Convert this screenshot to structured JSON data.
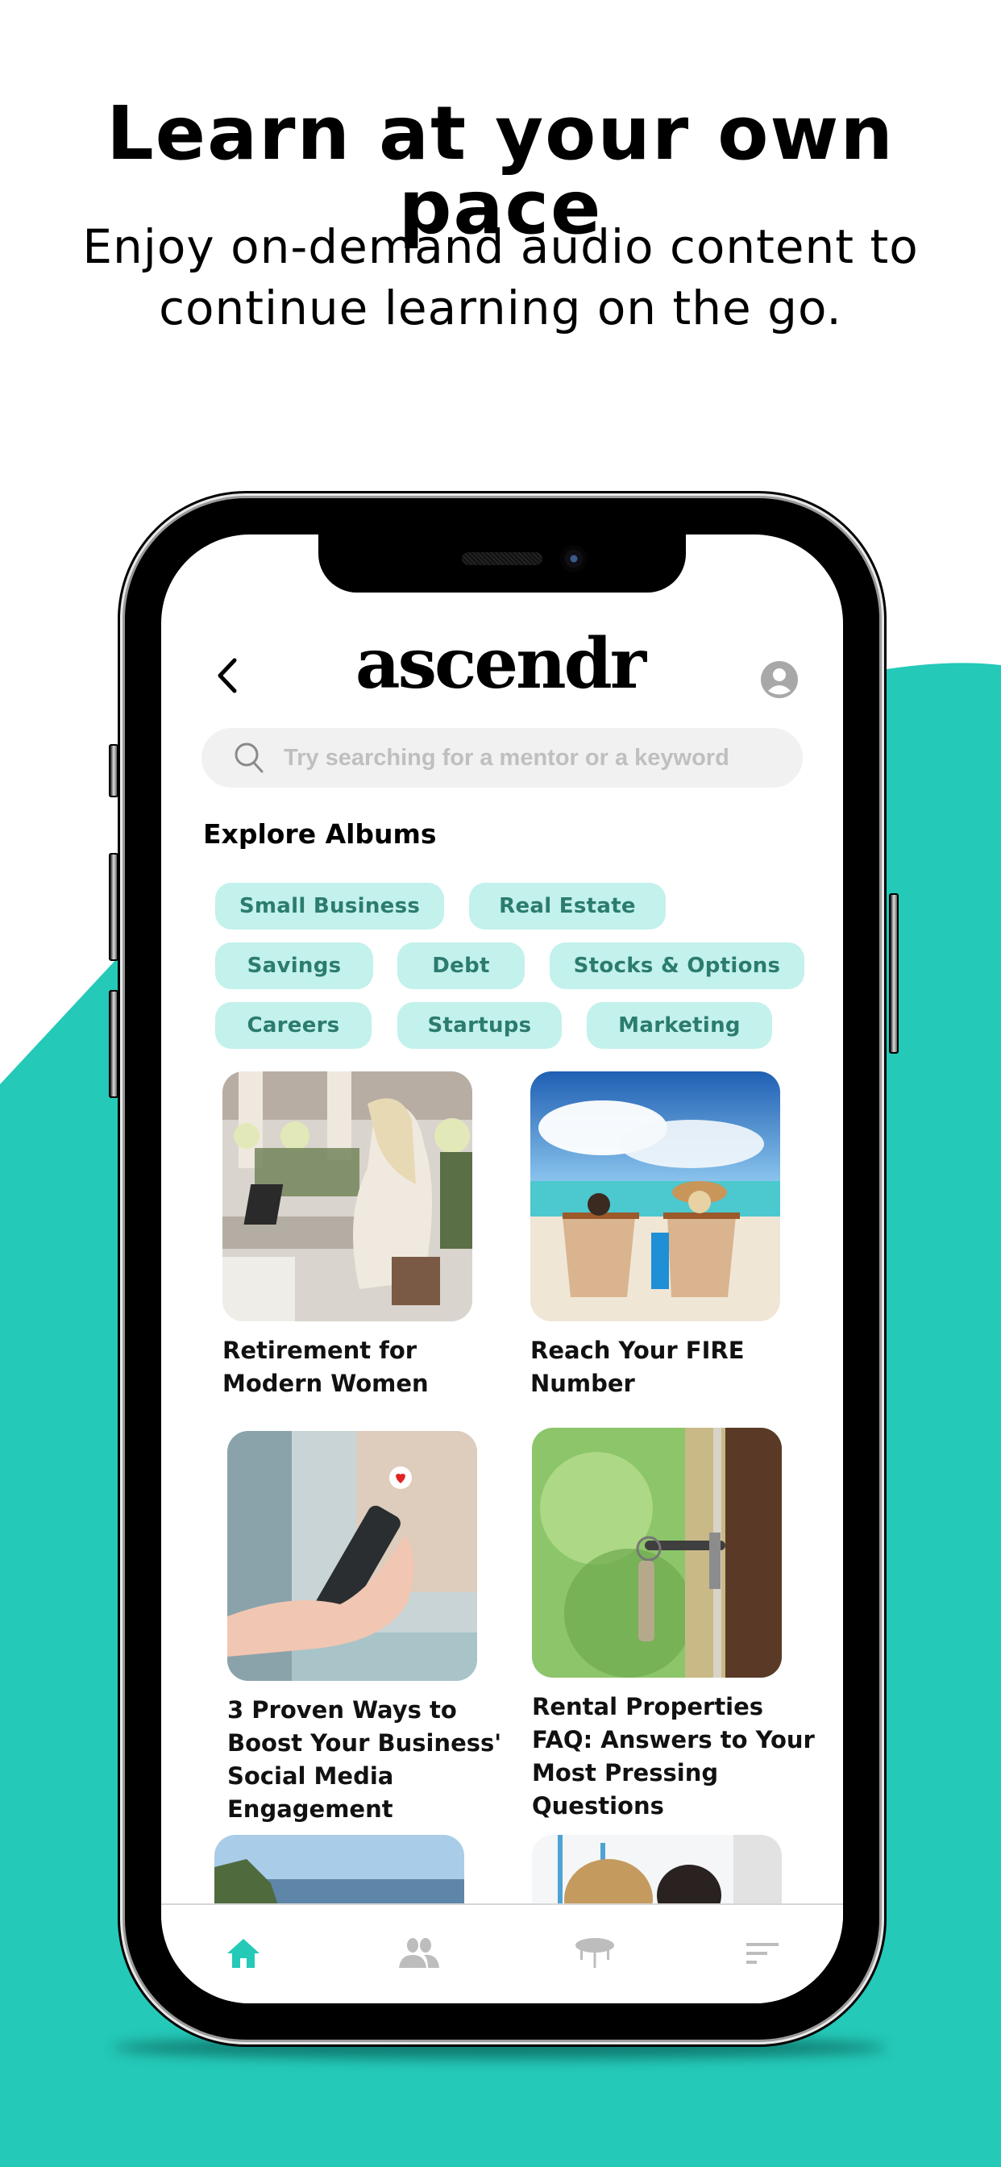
{
  "hero": {
    "title": "Learn at your own pace",
    "subtitle_line1": "Enjoy on-demand audio content to",
    "subtitle_line2": "continue learning on the go."
  },
  "colors": {
    "teal_background": "#24c9b8",
    "chip_background": "#c3f1ec",
    "chip_text": "#2b7c6e",
    "tab_active": "#24c9b8",
    "tab_inactive": "#bdbdbd"
  },
  "app": {
    "logo": "ascendr",
    "back_icon": "chevron-left-icon",
    "profile_icon": "user-avatar-icon",
    "search": {
      "placeholder": "Try searching for a mentor or a keyword",
      "value": "",
      "icon": "search-icon"
    },
    "section_title": "Explore Albums",
    "categories": [
      "Small Business",
      "Real Estate",
      "Savings",
      "Debt",
      "Stocks & Options",
      "Careers",
      "Startups",
      "Marketing"
    ],
    "albums": [
      {
        "title": "Retirement for Modern Women",
        "image": "woman-working-on-laptop-photo"
      },
      {
        "title": "Reach Your FIRE Number",
        "image": "beach-loungers-photo"
      },
      {
        "title": "3 Proven Ways to Boost Your Business' Social Media Engagement",
        "image": "hand-holding-phone-photo"
      },
      {
        "title": "Rental Properties FAQ: Answers to Your Most Pressing Questions",
        "image": "key-in-door-photo"
      },
      {
        "title": "",
        "image": "coastal-cliff-photo"
      },
      {
        "title": "",
        "image": "office-meeting-photo"
      }
    ],
    "tabbar": [
      {
        "name": "home",
        "icon": "home-icon",
        "active": true
      },
      {
        "name": "mentors",
        "icon": "people-icon",
        "active": false
      },
      {
        "name": "roundtable",
        "icon": "table-icon",
        "active": false
      },
      {
        "name": "feed",
        "icon": "sort-lines-icon",
        "active": false
      }
    ]
  }
}
